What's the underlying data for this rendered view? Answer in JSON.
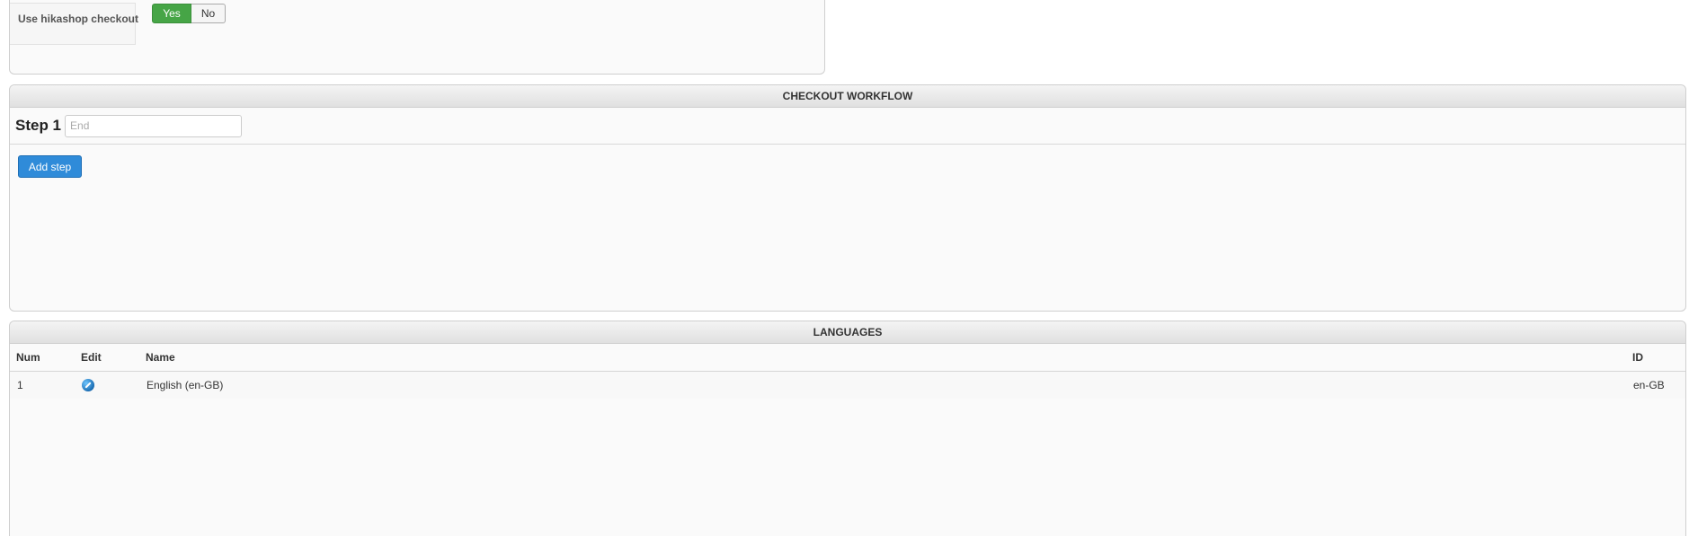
{
  "options": {
    "use_checkout_label": "Use hikashop checkout",
    "yes_label": "Yes",
    "no_label": "No",
    "selected": "Yes"
  },
  "workflow": {
    "title": "CHECKOUT WORKFLOW",
    "step_label": "Step 1",
    "step_placeholder": "End",
    "add_step_label": "Add step"
  },
  "languages": {
    "title": "LANGUAGES",
    "columns": {
      "num": "Num",
      "edit": "Edit",
      "name": "Name",
      "id": "ID"
    },
    "rows": [
      {
        "num": "1",
        "edit_icon": "edit-icon",
        "name": "English (en-GB)",
        "id": "en-GB"
      }
    ]
  },
  "colors": {
    "yes_active": "#46a546",
    "primary_button": "#2f8bd9"
  }
}
